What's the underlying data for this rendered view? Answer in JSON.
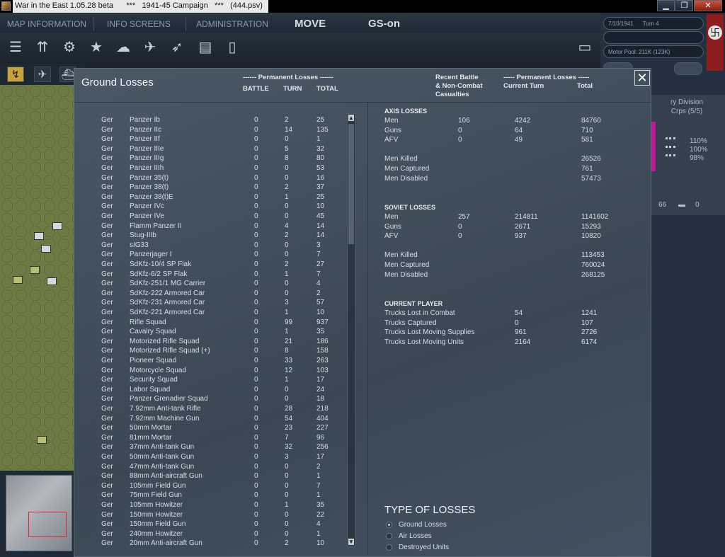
{
  "window": {
    "title": "War in the East 1.05.28 beta      ***   1941-45 Campaign   ***   (444.psv)",
    "min": "▁",
    "max": "❐",
    "close": "✕"
  },
  "topmenu": {
    "map_info": "MAP INFORMATION",
    "info_screens": "INFO SCREENS",
    "administration": "ADMINISTRATION",
    "move": "MOVE",
    "gs": "GS-on"
  },
  "status": {
    "date": "7/10/1941",
    "turn": "Turn 4",
    "motor_pool": "Motor Pool: 211K (123K)"
  },
  "unit_panel": {
    "title": "ry Division",
    "subtitle": "Crps (5/5)",
    "pct1": "110%",
    "pct2": "100%",
    "pct3": "98%",
    "count1": "66",
    "count2": "0"
  },
  "dialog": {
    "title": "Ground Losses",
    "hdr_perm_left": "------ Permanent Losses ------",
    "hdr_battle": "BATTLE",
    "hdr_turn": "TURN",
    "hdr_total": "TOTAL",
    "hdr_recent": "Recent Battle\n& Non-Combat\nCasualties",
    "hdr_perm_right": "----- Permanent Losses -----",
    "hdr_current_turn": "Current Turn",
    "hdr_total_r": "Total",
    "close": "✕"
  },
  "losses": [
    {
      "nat": "Ger",
      "name": "Panzer Ib",
      "battle": "0",
      "turn": "2",
      "total": "25"
    },
    {
      "nat": "Ger",
      "name": "Panzer IIc",
      "battle": "0",
      "turn": "14",
      "total": "135"
    },
    {
      "nat": "Ger",
      "name": "Panzer IIf",
      "battle": "0",
      "turn": "0",
      "total": "1"
    },
    {
      "nat": "Ger",
      "name": "Panzer IIIe",
      "battle": "0",
      "turn": "5",
      "total": "32"
    },
    {
      "nat": "Ger",
      "name": "Panzer IIIg",
      "battle": "0",
      "turn": "8",
      "total": "80"
    },
    {
      "nat": "Ger",
      "name": "Panzer IIIh",
      "battle": "0",
      "turn": "0",
      "total": "53"
    },
    {
      "nat": "Ger",
      "name": "Panzer 35(t)",
      "battle": "0",
      "turn": "0",
      "total": "16"
    },
    {
      "nat": "Ger",
      "name": "Panzer 38(t)",
      "battle": "0",
      "turn": "2",
      "total": "37"
    },
    {
      "nat": "Ger",
      "name": "Panzer 38(t)E",
      "battle": "0",
      "turn": "1",
      "total": "25"
    },
    {
      "nat": "Ger",
      "name": "Panzer IVc",
      "battle": "0",
      "turn": "0",
      "total": "10"
    },
    {
      "nat": "Ger",
      "name": "Panzer IVe",
      "battle": "0",
      "turn": "0",
      "total": "45"
    },
    {
      "nat": "Ger",
      "name": "Flamm Panzer II",
      "battle": "0",
      "turn": "4",
      "total": "14"
    },
    {
      "nat": "Ger",
      "name": "Stug-IIIb",
      "battle": "0",
      "turn": "2",
      "total": "14"
    },
    {
      "nat": "Ger",
      "name": "sIG33",
      "battle": "0",
      "turn": "0",
      "total": "3"
    },
    {
      "nat": "Ger",
      "name": "Panzerjager I",
      "battle": "0",
      "turn": "0",
      "total": "7"
    },
    {
      "nat": "Ger",
      "name": "SdKfz-10/4 SP Flak",
      "battle": "0",
      "turn": "2",
      "total": "27"
    },
    {
      "nat": "Ger",
      "name": "SdKfz-6/2 SP Flak",
      "battle": "0",
      "turn": "1",
      "total": "7"
    },
    {
      "nat": "Ger",
      "name": "SdKfz-251/1 MG Carrier",
      "battle": "0",
      "turn": "0",
      "total": "4"
    },
    {
      "nat": "Ger",
      "name": "SdKfz-222 Armored Car",
      "battle": "0",
      "turn": "0",
      "total": "2"
    },
    {
      "nat": "Ger",
      "name": "SdKfz-231 Armored Car",
      "battle": "0",
      "turn": "3",
      "total": "57"
    },
    {
      "nat": "Ger",
      "name": "SdKfz-221 Armored Car",
      "battle": "0",
      "turn": "1",
      "total": "10"
    },
    {
      "nat": "Ger",
      "name": "Rifle Squad",
      "battle": "0",
      "turn": "99",
      "total": "937"
    },
    {
      "nat": "Ger",
      "name": "Cavalry Squad",
      "battle": "0",
      "turn": "1",
      "total": "35"
    },
    {
      "nat": "Ger",
      "name": "Motorized Rifle Squad",
      "battle": "0",
      "turn": "21",
      "total": "186"
    },
    {
      "nat": "Ger",
      "name": "Motorized Rifle Squad (+)",
      "battle": "0",
      "turn": "8",
      "total": "158"
    },
    {
      "nat": "Ger",
      "name": "Pioneer Squad",
      "battle": "0",
      "turn": "33",
      "total": "263"
    },
    {
      "nat": "Ger",
      "name": "Motorcycle Squad",
      "battle": "0",
      "turn": "12",
      "total": "103"
    },
    {
      "nat": "Ger",
      "name": "Security Squad",
      "battle": "0",
      "turn": "1",
      "total": "17"
    },
    {
      "nat": "Ger",
      "name": "Labor Squad",
      "battle": "0",
      "turn": "0",
      "total": "24"
    },
    {
      "nat": "Ger",
      "name": "Panzer Grenadier Squad",
      "battle": "0",
      "turn": "0",
      "total": "18"
    },
    {
      "nat": "Ger",
      "name": "7.92mm Anti-tank Rifle",
      "battle": "0",
      "turn": "28",
      "total": "218"
    },
    {
      "nat": "Ger",
      "name": "7.92mm Machine Gun",
      "battle": "0",
      "turn": "54",
      "total": "404"
    },
    {
      "nat": "Ger",
      "name": "50mm Mortar",
      "battle": "0",
      "turn": "23",
      "total": "227"
    },
    {
      "nat": "Ger",
      "name": "81mm Mortar",
      "battle": "0",
      "turn": "7",
      "total": "96"
    },
    {
      "nat": "Ger",
      "name": "37mm Anti-tank Gun",
      "battle": "0",
      "turn": "32",
      "total": "256"
    },
    {
      "nat": "Ger",
      "name": "50mm Anti-tank Gun",
      "battle": "0",
      "turn": "3",
      "total": "17"
    },
    {
      "nat": "Ger",
      "name": "47mm Anti-tank Gun",
      "battle": "0",
      "turn": "0",
      "total": "2"
    },
    {
      "nat": "Ger",
      "name": "88mm Anti-aircraft Gun",
      "battle": "0",
      "turn": "0",
      "total": "1"
    },
    {
      "nat": "Ger",
      "name": "105mm Field Gun",
      "battle": "0",
      "turn": "0",
      "total": "7"
    },
    {
      "nat": "Ger",
      "name": "75mm Field Gun",
      "battle": "0",
      "turn": "0",
      "total": "1"
    },
    {
      "nat": "Ger",
      "name": "105mm Howitzer",
      "battle": "0",
      "turn": "1",
      "total": "35"
    },
    {
      "nat": "Ger",
      "name": "150mm Howitzer",
      "battle": "0",
      "turn": "0",
      "total": "22"
    },
    {
      "nat": "Ger",
      "name": "150mm Field Gun",
      "battle": "0",
      "turn": "0",
      "total": "4"
    },
    {
      "nat": "Ger",
      "name": "240mm Howitzer",
      "battle": "0",
      "turn": "0",
      "total": "1"
    },
    {
      "nat": "Ger",
      "name": "20mm Anti-aircraft Gun",
      "battle": "0",
      "turn": "2",
      "total": "10"
    }
  ],
  "axis": {
    "title": "AXIS LOSSES",
    "rows": [
      {
        "label": "Men",
        "battle": "106",
        "turn": "4242",
        "total": "84760"
      },
      {
        "label": "Guns",
        "battle": "0",
        "turn": "64",
        "total": "710"
      },
      {
        "label": "AFV",
        "battle": "0",
        "turn": "49",
        "total": "581"
      }
    ],
    "details": [
      {
        "label": "Men Killed",
        "total": "26526"
      },
      {
        "label": "Men Captured",
        "total": "761"
      },
      {
        "label": "Men Disabled",
        "total": "57473"
      }
    ]
  },
  "soviet": {
    "title": "SOVIET LOSSES",
    "rows": [
      {
        "label": "Men",
        "battle": "257",
        "turn": "214811",
        "total": "1141602"
      },
      {
        "label": "Guns",
        "battle": "0",
        "turn": "2671",
        "total": "15293"
      },
      {
        "label": "AFV",
        "battle": "0",
        "turn": "937",
        "total": "10820"
      }
    ],
    "details": [
      {
        "label": "Men Killed",
        "total": "113453"
      },
      {
        "label": "Men Captured",
        "total": "760024"
      },
      {
        "label": "Men Disabled",
        "total": "268125"
      }
    ]
  },
  "current_player": {
    "title": "CURRENT PLAYER",
    "rows": [
      {
        "label": "Trucks Lost in Combat",
        "turn": "54",
        "total": "1241"
      },
      {
        "label": "Trucks Captured",
        "turn": "0",
        "total": "107"
      },
      {
        "label": "Trucks Lost Moving Supplies",
        "turn": "961",
        "total": "2726"
      },
      {
        "label": "Trucks Lost Moving Units",
        "turn": "2164",
        "total": "6174"
      }
    ]
  },
  "type_of_losses": {
    "title": "TYPE OF LOSSES",
    "options": [
      {
        "label": "Ground Losses",
        "selected": true
      },
      {
        "label": "Air Losses",
        "selected": false
      },
      {
        "label": "Destroyed Units",
        "selected": false
      }
    ]
  }
}
